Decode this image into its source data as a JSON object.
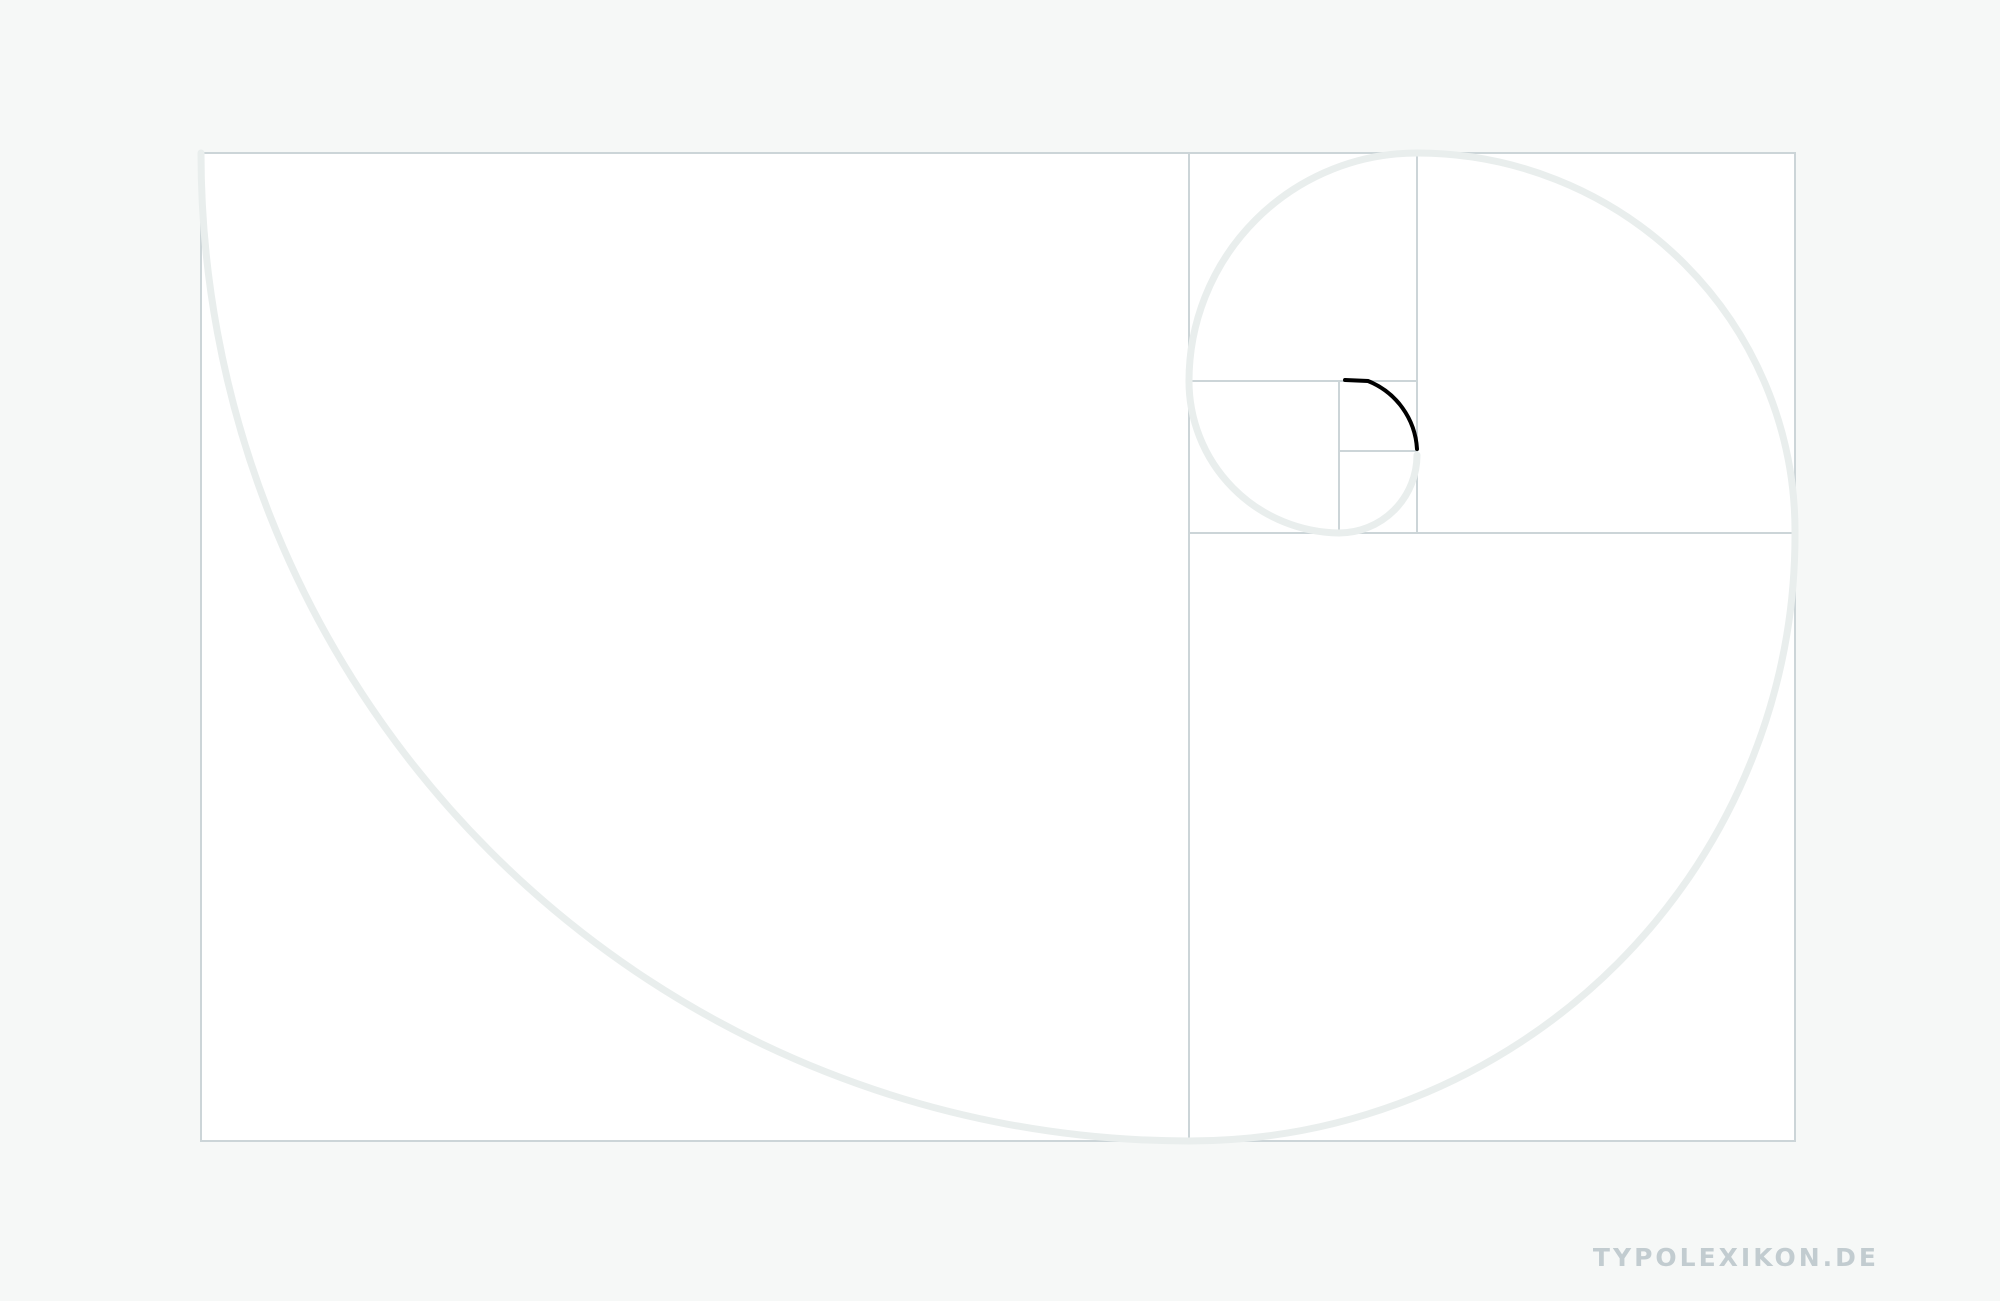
{
  "watermark": {
    "text": "TYPOLEXIKON.DE"
  },
  "diagram": {
    "kind": "golden-rectangle-fibonacci-spiral",
    "subdivisions": 7,
    "highlighted_segment": "innermost-arc"
  },
  "colors": {
    "page_background": "#f6f8f7",
    "canvas_background": "#ffffff",
    "grid_line": "#ccd5d8",
    "spiral_faded": "#e9eeed",
    "spiral_highlight": "#000000",
    "watermark": "#c2ccd0"
  }
}
